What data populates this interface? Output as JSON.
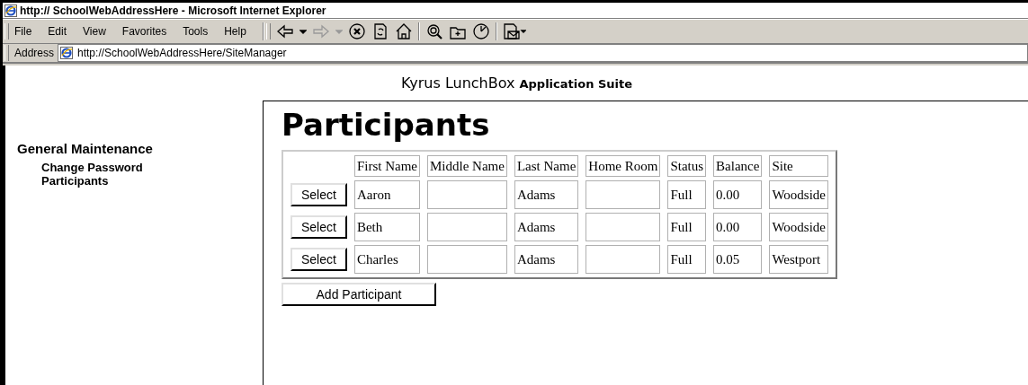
{
  "window": {
    "title": "http:// SchoolWebAddressHere - Microsoft Internet Explorer"
  },
  "menu": [
    "File",
    "Edit",
    "View",
    "Favorites",
    "Tools",
    "Help"
  ],
  "address": {
    "label": "Address",
    "value": "http://SchoolWebAddressHere/SiteManager"
  },
  "suite": {
    "brand": "Kyrus LunchBox",
    "suffix": "Application Suite"
  },
  "sidebar": {
    "heading": "General Maintenance",
    "items": [
      "Change Password",
      "Participants"
    ]
  },
  "page": {
    "title": "Participants",
    "columns": [
      "First Name",
      "Middle Name",
      "Last Name",
      "Home Room",
      "Status",
      "Balance",
      "Site"
    ],
    "rows": [
      {
        "action": "Select",
        "cells": [
          "Aaron",
          "",
          "Adams",
          "",
          "Full",
          "0.00",
          "Woodside"
        ]
      },
      {
        "action": "Select",
        "cells": [
          "Beth",
          "",
          "Adams",
          "",
          "Full",
          "0.00",
          "Woodside"
        ]
      },
      {
        "action": "Select",
        "cells": [
          "Charles",
          "",
          "Adams",
          "",
          "Full",
          "0.05",
          "Westport"
        ]
      }
    ],
    "add_button": "Add Participant"
  }
}
